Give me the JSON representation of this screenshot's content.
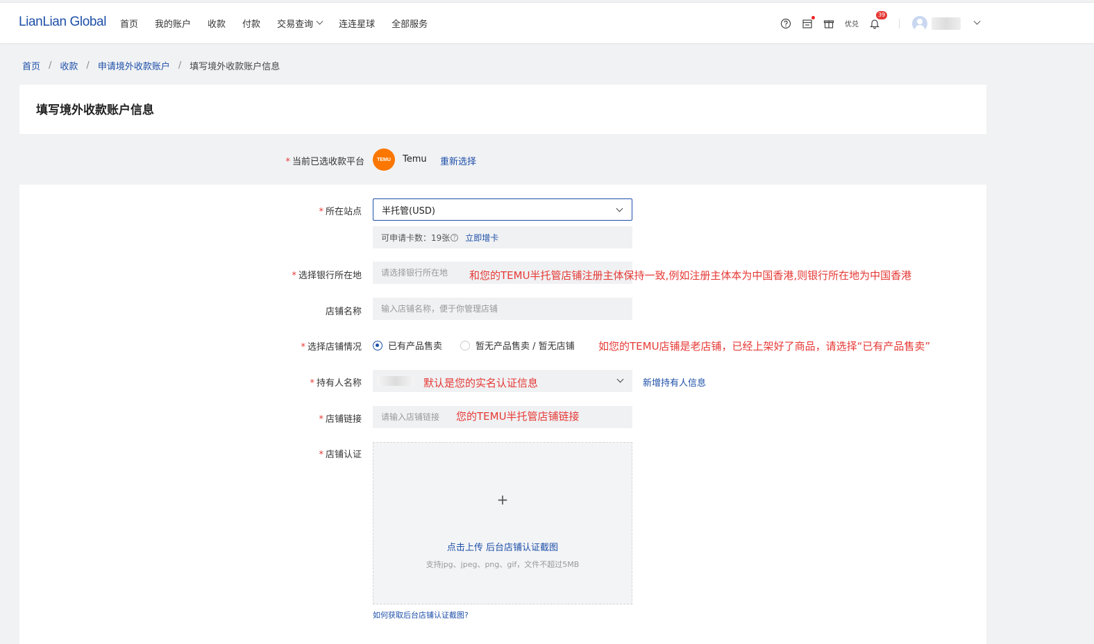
{
  "app": {
    "logo": "LianLian Global"
  },
  "nav": {
    "items": [
      "首页",
      "我的账户",
      "收款",
      "付款",
      "交易查询",
      "连连星球",
      "全部服务"
    ]
  },
  "header_tools": {
    "help_icon": "question-circle-icon",
    "calendar_icon": "calendar-icon",
    "gift_icon": "gift-icon",
    "redeem_label": "优兑",
    "bell_icon": "bell-icon",
    "notification_count": "39"
  },
  "breadcrumb": {
    "items": [
      "首页",
      "收款",
      "申请境外收款账户"
    ],
    "current": "填写境外收款账户信息"
  },
  "page": {
    "title": "填写境外收款账户信息"
  },
  "form": {
    "platform": {
      "label": "当前已选收款平台",
      "logo_text": "TEMU",
      "value": "Temu",
      "reselect": "重新选择"
    },
    "site": {
      "label": "所在站点",
      "value": "半托管(USD)",
      "quota_label": "可申请卡数：19张",
      "add_card": "立即增卡"
    },
    "bank_location": {
      "label": "选择银行所在地",
      "placeholder": "请选择银行所在地"
    },
    "store_name": {
      "label": "店铺名称",
      "placeholder": "输入店铺名称，便于你管理店铺"
    },
    "store_status": {
      "label": "选择店铺情况",
      "options": [
        "已有产品售卖",
        "暂无产品售卖 / 暂无店铺"
      ],
      "selected": 0
    },
    "holder": {
      "label": "持有人名称",
      "add": "新增持有人信息"
    },
    "store_link": {
      "label": "店铺链接",
      "placeholder": "请输入店铺链接"
    },
    "store_auth": {
      "label": "店铺认证",
      "plus": "+",
      "upload_text": "点击上传 后台店铺认证截图",
      "upload_hint": "支持jpg、jpeg、png、gif，文件不超过5MB",
      "help_link": "如何获取后台店铺认证截图?"
    },
    "required_mark": "*"
  },
  "annotations": {
    "bank_location": "和您的TEMU半托管店铺注册主体保持一致,例如注册主体本为中国香港,则银行所在地为中国香港",
    "store_status": "如您的TEMU店铺是老店铺，已经上架好了商品，请选择“已有产品售卖”",
    "holder": "默认是您的实名认证信息",
    "store_link": "您的TEMU半托管店铺链接"
  },
  "colors": {
    "brand_blue": "#1d4fa8",
    "required_red": "#e53935",
    "annotation_red": "#e53935",
    "temu_orange": "#fb7701"
  }
}
